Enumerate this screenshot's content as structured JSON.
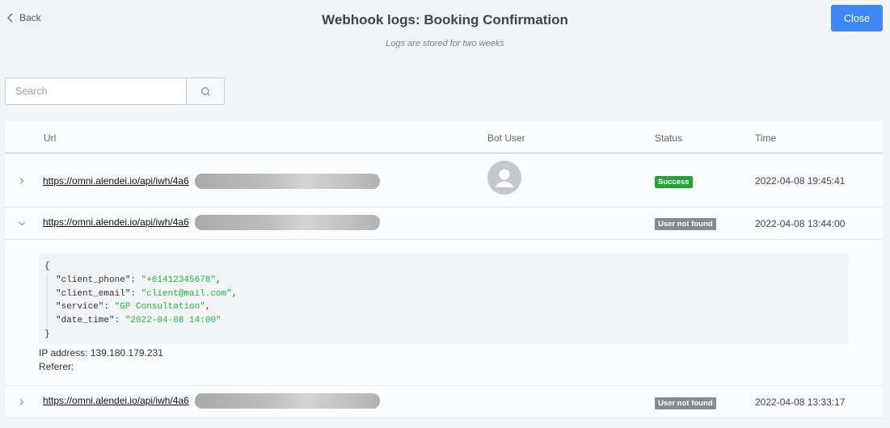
{
  "header": {
    "back_label": "Back",
    "title": "Webhook logs: Booking Confirmation",
    "subtitle": "Logs are stored for two weeks",
    "close_label": "Close"
  },
  "search": {
    "placeholder": "Search"
  },
  "table": {
    "columns": {
      "url": "Url",
      "bot_user": "Bot User",
      "status": "Status",
      "time": "Time"
    },
    "rows": [
      {
        "url": "https://omni.alendei.io/api/iwh/4a6",
        "status": "Success",
        "time": "2022-04-08 19:45:41",
        "expanded": false,
        "has_avatar": true
      },
      {
        "url": "https://omni.alendei.io/api/iwh/4a6",
        "status": "User not found",
        "time": "2022-04-08 13:44:00",
        "expanded": true,
        "has_avatar": false
      },
      {
        "url": "https://omni.alendei.io/api/iwh/4a6",
        "status": "User not found",
        "time": "2022-04-08 13:33:17",
        "expanded": false,
        "has_avatar": false
      }
    ]
  },
  "detail": {
    "open_brace": "{",
    "close_brace": "}",
    "fields": [
      {
        "key": "\"client_phone\"",
        "value": "\"+61412345678\""
      },
      {
        "key": "\"client_email\"",
        "value": "\"client@mail.com\""
      },
      {
        "key": "\"service\"",
        "value": "\"GP Consultation\""
      },
      {
        "key": "\"date_time\"",
        "value": "\"2022-04-08 14:00\""
      }
    ],
    "ip_label": "IP address: 139.180.179.231",
    "referer_label": "Referer:"
  },
  "colors": {
    "accent": "#3f87f5",
    "success": "#22a33c",
    "not_found": "#868b91",
    "json_string": "#22b14c"
  },
  "icons": {
    "back": "chevron-left-icon",
    "search": "search-icon",
    "expand": "chevron-right-icon",
    "collapse": "chevron-down-icon",
    "avatar": "user-avatar-icon"
  }
}
